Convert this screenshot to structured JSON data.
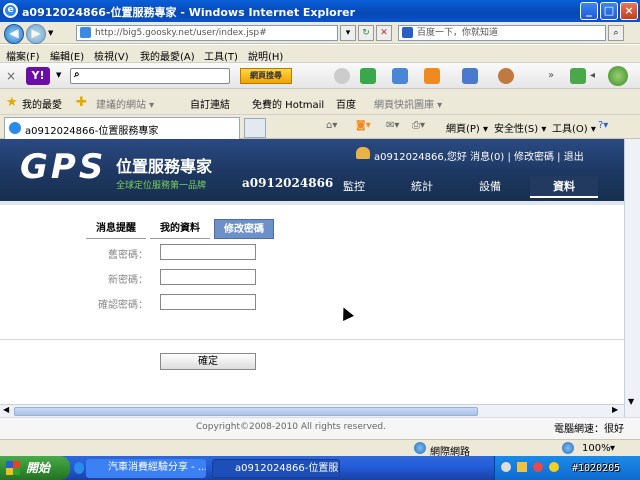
{
  "window": {
    "title": "a0912024866-位置服務專家 - Windows Internet Explorer"
  },
  "address": {
    "url": "http://big5.goosky.net/user/index.jsp#",
    "search_placeholder": "百度一下，你就知道"
  },
  "menu": [
    "檔案(F)",
    "編輯(E)",
    "檢視(V)",
    "我的最愛(A)",
    "工具(T)",
    "說明(H)"
  ],
  "yahoo": {
    "logo": "Y!",
    "search_button": "網頁搜尋"
  },
  "favorites": {
    "label": "我的最愛",
    "links": [
      "建議的網站 ▾",
      "自訂連結",
      "免費的 Hotmail",
      "百度",
      "網頁快訊圖庫 ▾"
    ]
  },
  "tab": {
    "title": "a0912024866-位置服務專家"
  },
  "toolbar_right": [
    "網頁(P) ▾",
    "安全性(S) ▾",
    "工具(O) ▾"
  ],
  "site": {
    "logo": "GPS",
    "title": "位置服務專家",
    "subtitle": "全球定位服務第一品牌",
    "account": "a0912024866",
    "user_links": "a0912024866,您好  消息(0)  |  修改密碼  |  退出",
    "nav": [
      "監控",
      "統計",
      "設備",
      "資料"
    ],
    "subtabs": [
      "消息提醒",
      "我的資料",
      "修改密碼"
    ],
    "form": {
      "old_password_label": "舊密碼：",
      "new_password_label": "新密碼：",
      "confirm_password_label": "確認密碼：",
      "submit_label": "確定"
    },
    "copyright": "Copyright©2008-2010 All rights reserved.",
    "network_speed": "電腦網速：很好"
  },
  "status": {
    "zone": "網際網路",
    "zoom": "100%"
  },
  "taskbar": {
    "start": "開始",
    "items": [
      "汽車消費經驗分享 - ...",
      "a0912024866-位置服..."
    ]
  },
  "watermark": "#1020205"
}
